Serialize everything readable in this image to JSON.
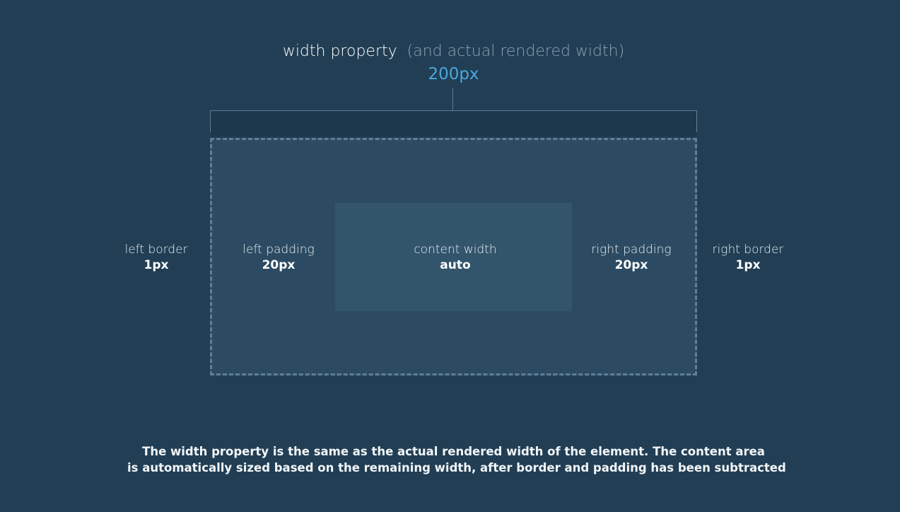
{
  "header": {
    "title": "width property",
    "subtitle": "(and actual rendered width)",
    "value": "200px"
  },
  "labels": {
    "left_border": {
      "name": "left border",
      "value": "1px"
    },
    "left_padding": {
      "name": "left padding",
      "value": "20px"
    },
    "content_width": {
      "name": "content width",
      "value": "auto"
    },
    "right_padding": {
      "name": "right padding",
      "value": "20px"
    },
    "right_border": {
      "name": "right border",
      "value": "1px"
    }
  },
  "footer": {
    "line1": "The width property is the same as the actual rendered width of the element. The content area",
    "line2": "is automatically sized based on the remaining width, after border and padding has been subtracted"
  },
  "colors": {
    "background": "#213e54",
    "box_fill": "#2c4b62",
    "content_fill": "#33556c",
    "dashed_border": "#5e7f99",
    "accent_value": "#4aa8dc",
    "muted_text": "#8ba3b8"
  }
}
